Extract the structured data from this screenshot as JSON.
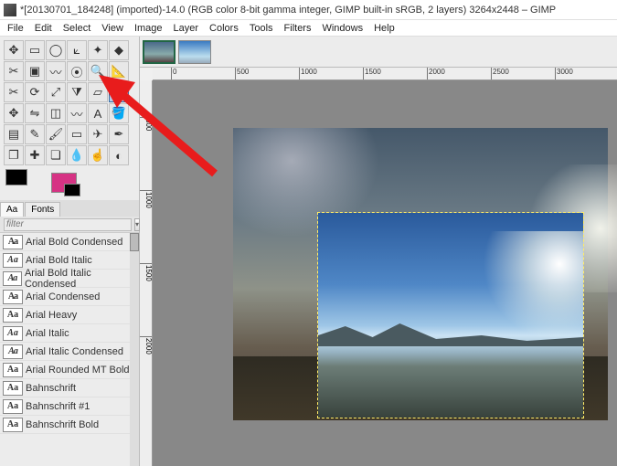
{
  "title": "*[20130701_184248] (imported)-14.0 (RGB color 8-bit gamma integer, GIMP built-in sRGB, 2 layers) 3264x2448 – GIMP",
  "menu": [
    "File",
    "Edit",
    "Select",
    "View",
    "Image",
    "Layer",
    "Colors",
    "Tools",
    "Filters",
    "Windows",
    "Help"
  ],
  "toolbox_icons": [
    "move",
    "rect-select",
    "ellipse-select",
    "free-select",
    "fuzzy-select",
    "color-select",
    "scissors",
    "foreground-select",
    "paths",
    "color-picker",
    "zoom",
    "measure",
    "crop",
    "rotate",
    "scale",
    "shear",
    "perspective",
    "unified-transform",
    "handle-transform",
    "flip",
    "cage",
    "warp",
    "text",
    "bucket-fill",
    "gradient",
    "pencil",
    "paintbrush",
    "eraser",
    "airbrush",
    "ink",
    "clone",
    "heal",
    "perspective-clone",
    "blur",
    "smudge",
    "dodge"
  ],
  "highlighted_tool_index": 17,
  "swatch": {
    "fg": "#000000",
    "bg": "#d63384"
  },
  "tabs": {
    "items": [
      "Aa",
      "Fonts"
    ],
    "active": 0
  },
  "filter_placeholder": "filter",
  "fonts": [
    {
      "label": "Arial Bold Condensed",
      "style": "bold cond"
    },
    {
      "label": "Arial Bold Italic",
      "style": "bold ital"
    },
    {
      "label": "Arial Bold Italic Condensed",
      "style": "bold ital cond"
    },
    {
      "label": "Arial Condensed",
      "style": "cond"
    },
    {
      "label": "Arial Heavy",
      "style": "heavy"
    },
    {
      "label": "Arial Italic",
      "style": "ital"
    },
    {
      "label": "Arial Italic Condensed",
      "style": "ital cond"
    },
    {
      "label": "Arial Rounded MT Bold,",
      "style": "bold"
    },
    {
      "label": "Bahnschrift",
      "style": ""
    },
    {
      "label": "Bahnschrift #1",
      "style": ""
    },
    {
      "label": "Bahnschrift Bold",
      "style": "bold"
    }
  ],
  "ruler_h": [
    "0",
    "500",
    "1000",
    "1500",
    "2000",
    "2500",
    "3000"
  ],
  "ruler_v": [
    "500",
    "1000",
    "1500",
    "2000"
  ],
  "thumbnails": 2,
  "arrow_points_to": "unified-transform tool"
}
